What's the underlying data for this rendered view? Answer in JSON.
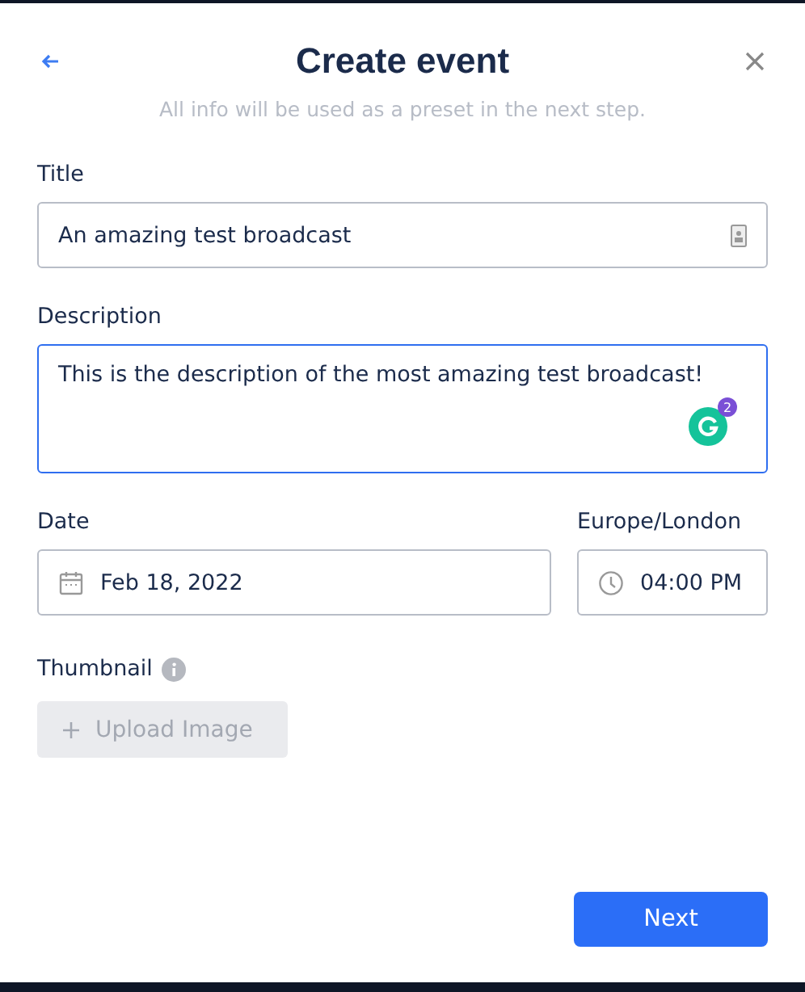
{
  "dialog": {
    "title": "Create event",
    "subtitle": "All info will be used as a preset in the next step."
  },
  "fields": [
    {
      "kind": "text",
      "label": "Title",
      "value": "An amazing test broadcast",
      "focused": false
    },
    {
      "kind": "textarea",
      "label": "Description",
      "value": "This is the description of the most amazing test broadcast!",
      "focused": true,
      "assistant_badge": "2"
    }
  ],
  "date": {
    "label": "Date",
    "value": "Feb 18, 2022"
  },
  "time": {
    "label": "Europe/London",
    "value": "04:00 PM"
  },
  "thumbnail": {
    "label": "Thumbnail",
    "button": {
      "label": "Upload Image",
      "disabled": true
    }
  },
  "buttons": [
    {
      "label": "Next"
    }
  ]
}
